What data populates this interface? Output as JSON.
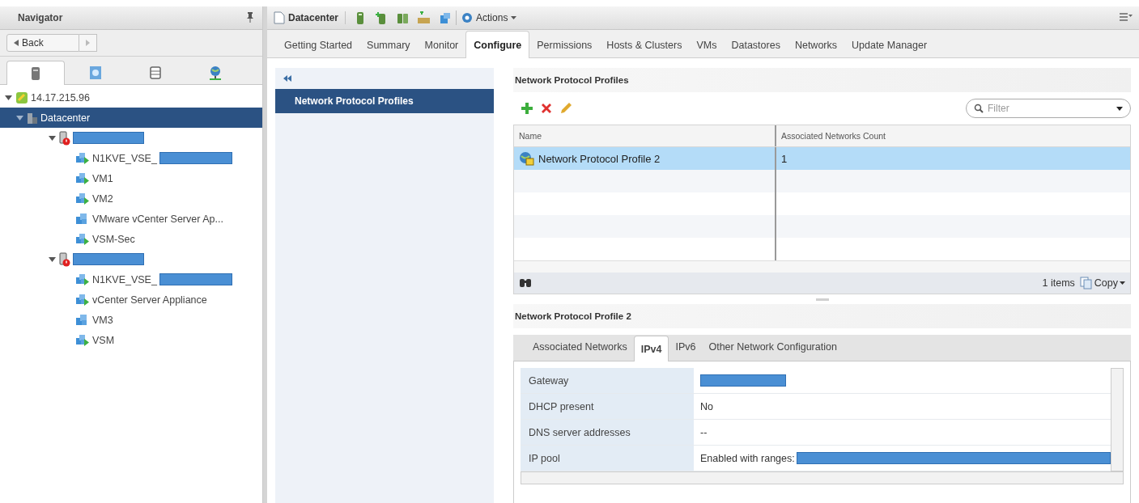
{
  "navigator": {
    "title": "Navigator",
    "back": "Back",
    "tabs": [
      {
        "kind": "hosts",
        "selected": true
      },
      {
        "kind": "vms",
        "selected": false
      },
      {
        "kind": "storage",
        "selected": false
      },
      {
        "kind": "network",
        "selected": false
      }
    ],
    "tree": [
      {
        "label": "14.17.215.96",
        "kind": "vcenter",
        "expanded": true,
        "selected": false,
        "children": [
          {
            "label": "Datacenter",
            "kind": "datacenter",
            "expanded": true,
            "selected": true,
            "children": [
              {
                "kind": "host",
                "redacted": true,
                "expanded": true,
                "selected": false,
                "children": [
                  {
                    "label": "N1KVE_VSE_",
                    "kind": "vm-on",
                    "redacted": true,
                    "selected": false
                  },
                  {
                    "label": "VM1",
                    "kind": "vm-on",
                    "selected": false
                  },
                  {
                    "label": "VM2",
                    "kind": "vm-on",
                    "selected": false
                  },
                  {
                    "label": "VMware vCenter Server Ap...",
                    "kind": "vm-off",
                    "selected": false
                  },
                  {
                    "label": "VSM-Sec",
                    "kind": "vm-on",
                    "selected": false
                  }
                ]
              },
              {
                "kind": "host",
                "redacted": true,
                "expanded": true,
                "selected": false,
                "children": [
                  {
                    "label": "N1KVE_VSE_",
                    "kind": "vm-on",
                    "redacted": true,
                    "selected": false
                  },
                  {
                    "label": "vCenter Server Appliance",
                    "kind": "vm-on",
                    "selected": false
                  },
                  {
                    "label": "VM3",
                    "kind": "vm-off",
                    "selected": false
                  },
                  {
                    "label": "VSM",
                    "kind": "vm-on",
                    "selected": false
                  }
                ]
              }
            ]
          }
        ]
      }
    ]
  },
  "toolbar": {
    "title": "Datacenter",
    "actions": "Actions"
  },
  "tabs": [
    {
      "label": "Getting Started",
      "selected": false
    },
    {
      "label": "Summary",
      "selected": false
    },
    {
      "label": "Monitor",
      "selected": false
    },
    {
      "label": "Configure",
      "selected": true
    },
    {
      "label": "Permissions",
      "selected": false
    },
    {
      "label": "Hosts & Clusters",
      "selected": false
    },
    {
      "label": "VMs",
      "selected": false
    },
    {
      "label": "Datastores",
      "selected": false
    },
    {
      "label": "Networks",
      "selected": false
    },
    {
      "label": "Update Manager",
      "selected": false
    }
  ],
  "sidebar": {
    "items": [
      {
        "label": "Network Protocol Profiles",
        "selected": true
      }
    ]
  },
  "profiles": {
    "title": "Network Protocol Profiles",
    "filter": {
      "placeholder": "Filter"
    },
    "columns": [
      "Name",
      "Associated Networks Count"
    ],
    "rows": [
      {
        "cells": [
          "Network Protocol Profile 2",
          "1"
        ],
        "selected": true
      }
    ],
    "count": "1 items",
    "copy": "Copy"
  },
  "details": {
    "title": "Network Protocol Profile 2",
    "tabs": [
      {
        "label": "Associated Networks",
        "selected": false
      },
      {
        "label": "IPv4",
        "selected": true
      },
      {
        "label": "IPv6",
        "selected": false
      },
      {
        "label": "Other Network Configuration",
        "selected": false
      }
    ],
    "properties": [
      {
        "label": "Gateway",
        "redacted": true
      },
      {
        "label": "DHCP present",
        "value": "No"
      },
      {
        "label": "DNS server addresses",
        "value": "--"
      },
      {
        "label": "IP pool",
        "value": "Enabled with ranges:",
        "redacted": true
      }
    ]
  }
}
